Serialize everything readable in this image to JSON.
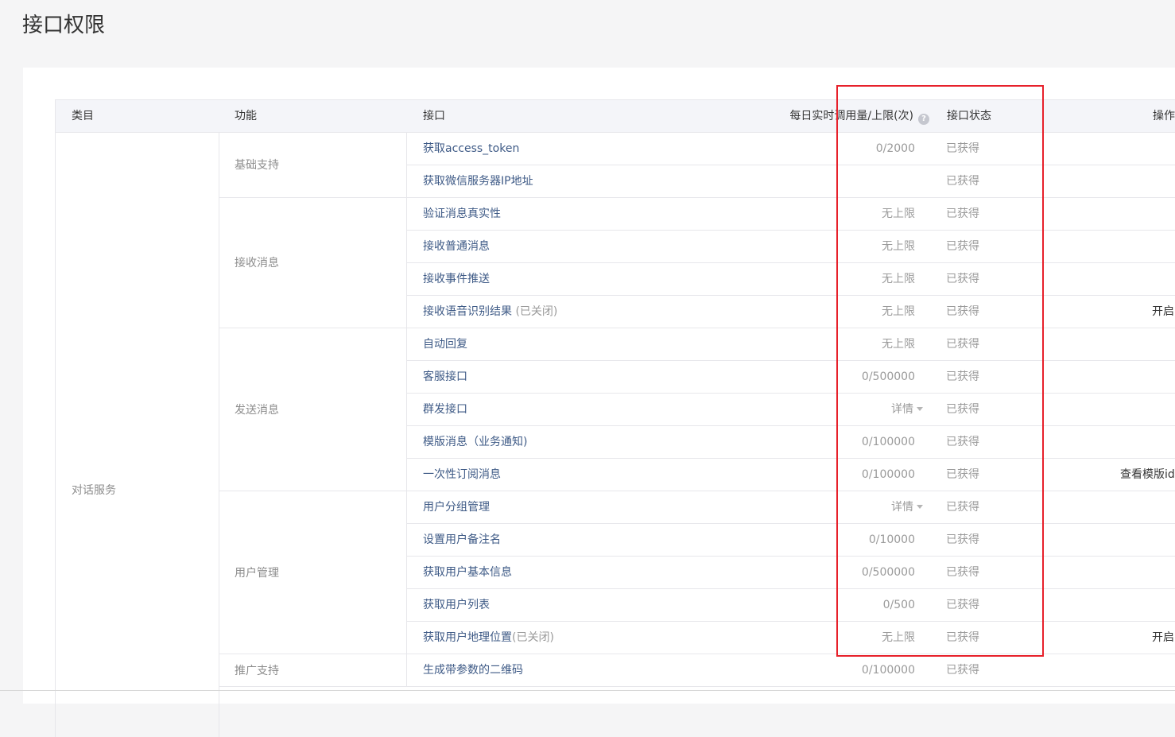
{
  "page": {
    "title": "接口权限"
  },
  "table": {
    "headers": {
      "category": "类目",
      "function": "功能",
      "api": "接口",
      "quota": "每日实时调用量/上限(次)",
      "status": "接口状态",
      "operation": "操作"
    },
    "help_icon_glyph": "?",
    "category": "对话服务",
    "groups": [
      {
        "label": "基础支持",
        "rows": [
          {
            "name": "获取access_token",
            "note": "",
            "quota": "0/2000",
            "dropdown": false,
            "status": "已获得",
            "op": ""
          },
          {
            "name": "获取微信服务器IP地址",
            "note": "",
            "quota": "",
            "dropdown": false,
            "status": "已获得",
            "op": ""
          }
        ]
      },
      {
        "label": "接收消息",
        "rows": [
          {
            "name": "验证消息真实性",
            "note": "",
            "quota": "无上限",
            "dropdown": false,
            "status": "已获得",
            "op": ""
          },
          {
            "name": "接收普通消息",
            "note": "",
            "quota": "无上限",
            "dropdown": false,
            "status": "已获得",
            "op": ""
          },
          {
            "name": "接收事件推送",
            "note": "",
            "quota": "无上限",
            "dropdown": false,
            "status": "已获得",
            "op": ""
          },
          {
            "name": "接收语音识别结果",
            "note": " (已关闭)",
            "quota": "无上限",
            "dropdown": false,
            "status": "已获得",
            "op": "开启"
          }
        ]
      },
      {
        "label": "发送消息",
        "rows": [
          {
            "name": "自动回复",
            "note": "",
            "quota": "无上限",
            "dropdown": false,
            "status": "已获得",
            "op": ""
          },
          {
            "name": "客服接口",
            "note": "",
            "quota": "0/500000",
            "dropdown": false,
            "status": "已获得",
            "op": ""
          },
          {
            "name": "群发接口",
            "note": "",
            "quota": "详情",
            "dropdown": true,
            "status": "已获得",
            "op": ""
          },
          {
            "name": "模版消息（业务通知)",
            "note": "",
            "quota": "0/100000",
            "dropdown": false,
            "status": "已获得",
            "op": ""
          },
          {
            "name": "一次性订阅消息",
            "note": "",
            "quota": "0/100000",
            "dropdown": false,
            "status": "已获得",
            "op": "查看模版id"
          }
        ]
      },
      {
        "label": "用户管理",
        "rows": [
          {
            "name": "用户分组管理",
            "note": "",
            "quota": "详情",
            "dropdown": true,
            "status": "已获得",
            "op": ""
          },
          {
            "name": "设置用户备注名",
            "note": "",
            "quota": "0/10000",
            "dropdown": false,
            "status": "已获得",
            "op": ""
          },
          {
            "name": "获取用户基本信息",
            "note": "",
            "quota": "0/500000",
            "dropdown": false,
            "status": "已获得",
            "op": ""
          },
          {
            "name": "获取用户列表",
            "note": "",
            "quota": "0/500",
            "dropdown": false,
            "status": "已获得",
            "op": ""
          },
          {
            "name": "获取用户地理位置",
            "note": "(已关闭)",
            "quota": "无上限",
            "dropdown": false,
            "status": "已获得",
            "op": "开启"
          }
        ]
      },
      {
        "label": "推广支持",
        "rows": [
          {
            "name": "生成带参数的二维码",
            "note": "",
            "quota": "0/100000",
            "dropdown": false,
            "status": "已获得",
            "op": ""
          }
        ]
      }
    ]
  },
  "colors": {
    "link": "#3e5a86",
    "muted": "#9a9a9a",
    "highlight": "#e7212b",
    "header_bg": "#f4f5f9",
    "border": "#e7e7eb"
  }
}
